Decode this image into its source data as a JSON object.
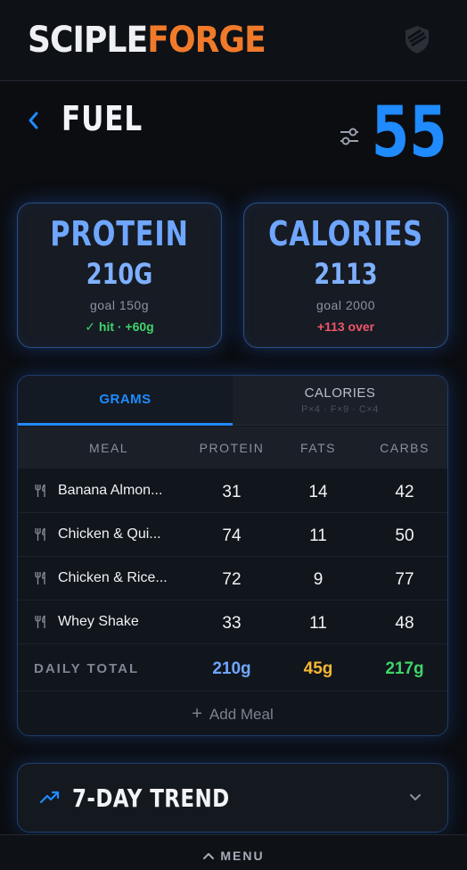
{
  "header": {
    "brand_part1": "SCIPLE",
    "brand_part2": "FORGE",
    "brand_color_1": "#eef0f3",
    "brand_color_2": "#f07a2a",
    "icon": "shield-icon"
  },
  "page": {
    "title": "FUEL",
    "score": "55",
    "back_icon": "chevron-left-icon",
    "filter_icon": "sliders-icon",
    "accent": "#1f8bff"
  },
  "stats": {
    "protein": {
      "label": "PROTEIN",
      "value": "210G",
      "goal": "goal 150g",
      "status": "✓ hit · +60g"
    },
    "calories": {
      "label": "CALORIES",
      "value": "2113",
      "goal": "goal 2000",
      "status": "+113 over"
    }
  },
  "tabs": [
    {
      "label": "GRAMS",
      "sub": ""
    },
    {
      "label": "CALORIES",
      "sub": "P×4 · F×9 · C×4"
    }
  ],
  "table": {
    "headers": [
      "MEAL",
      "PROTEIN",
      "FATS",
      "CARBS"
    ],
    "rows": [
      {
        "meal": "Banana Almon...",
        "protein": "31",
        "fats": "14",
        "carbs": "42"
      },
      {
        "meal": "Chicken & Qui...",
        "protein": "74",
        "fats": "11",
        "carbs": "50"
      },
      {
        "meal": "Chicken & Rice...",
        "protein": "72",
        "fats": "9",
        "carbs": "77"
      },
      {
        "meal": "Whey Shake",
        "protein": "33",
        "fats": "11",
        "carbs": "48"
      }
    ],
    "total": {
      "label": "DAILY TOTAL",
      "protein": "210g",
      "fats": "45g",
      "carbs": "217g"
    },
    "add_label": "Add Meal",
    "row_icon": "fork-knife-icon"
  },
  "trend": {
    "label": "7-DAY TREND",
    "icon": "trending-up-icon",
    "chevron": "chevron-down-icon"
  },
  "bottom": {
    "menu_label": "MENU",
    "icon": "chevron-up-icon"
  },
  "colors": {
    "protein": "#6fa6ff",
    "fats": "#f7b733",
    "carbs": "#3fd46a",
    "over": "#f0566a"
  }
}
